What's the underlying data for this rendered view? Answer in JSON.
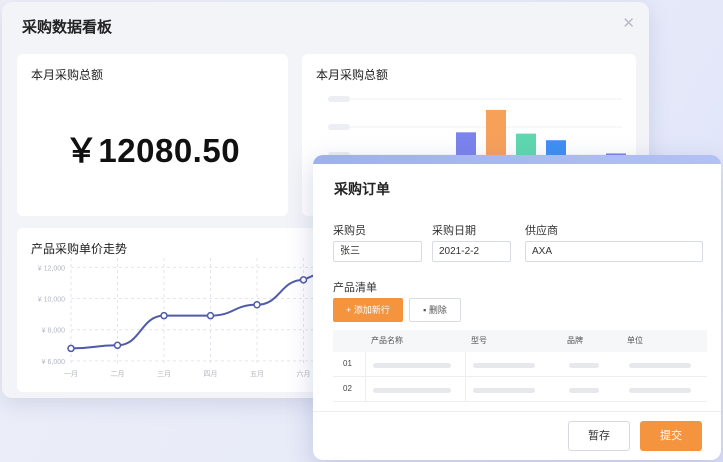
{
  "dashboard": {
    "title": "采购数据看板",
    "close_glyph": "✕",
    "total_card": {
      "title": "本月采购总额",
      "value": "￥12080.50"
    },
    "bar_card": {
      "title": "本月采购总额"
    },
    "trend_card": {
      "title": "产品采购单价走势"
    }
  },
  "chart_data": [
    {
      "type": "bar",
      "title": "本月采购总额",
      "values": [
        null,
        0.48,
        0.82,
        0.46,
        0.36,
        null,
        0.16
      ],
      "colors": [
        "#7b83ec",
        "#7b83ec",
        "#f6a05a",
        "#5fd8ae",
        "#3f8ff3",
        "#7b83ec",
        "#7b83ec"
      ],
      "grid": true,
      "note": "bars partially hidden behind the order dialog; values are relative heights"
    },
    {
      "type": "line",
      "title": "产品采购单价走势",
      "categories": [
        "一月",
        "二月",
        "三月",
        "四月",
        "五月",
        "六月"
      ],
      "y_ticks": [
        "¥ 12,000",
        "¥ 10,000",
        "¥ 8,000",
        "¥ 6,000"
      ],
      "y_tick_values": [
        12000,
        10000,
        8000,
        6000
      ],
      "ylim": [
        5800,
        12600
      ],
      "values": [
        6800,
        7000,
        8900,
        8900,
        9600,
        11200
      ],
      "line_color": "#4f5aa8",
      "grid": true
    }
  ],
  "order": {
    "title": "采购订单",
    "fields": {
      "buyer_label": "采购员",
      "buyer_value": "张三",
      "date_label": "采购日期",
      "date_value": "2021-2-2",
      "supplier_label": "供应商",
      "supplier_value": "AXA"
    },
    "product_list_label": "产品清单",
    "add_row_label": "+ 添加新行",
    "delete_label": "▪ 删除",
    "table": {
      "headers": [
        "产品名称",
        "型号",
        "品牌",
        "单位"
      ],
      "rows": [
        {
          "no": "01"
        },
        {
          "no": "02"
        }
      ]
    },
    "save_label": "暂存",
    "submit_label": "提交"
  }
}
